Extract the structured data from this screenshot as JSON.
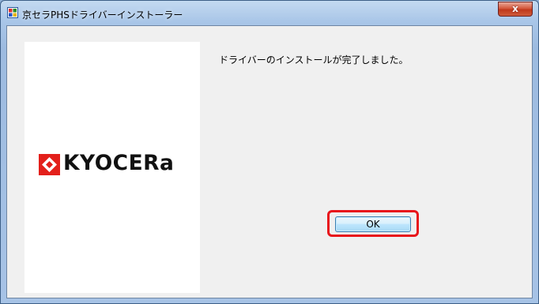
{
  "window": {
    "title": "京セラPHSドライバーインストーラー",
    "close_label": "x"
  },
  "logo": {
    "text": "KYOCERa",
    "mark_color": "#e3201b"
  },
  "main": {
    "message": "ドライバーのインストールが完了しました。",
    "ok_label": "OK"
  },
  "colors": {
    "highlight": "#e8141b",
    "dialog_background": "#f0f0f0",
    "titlebar": "#b6cfee"
  }
}
